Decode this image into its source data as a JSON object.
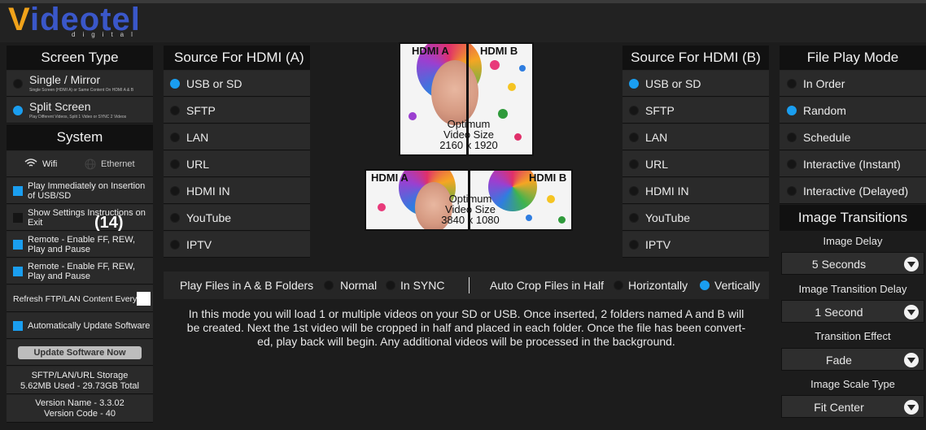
{
  "app": {
    "logo_main": "ideotel",
    "logo_v": "V",
    "logo_sub": "digital"
  },
  "screen_type": {
    "header": "Screen Type",
    "options": [
      {
        "label": "Single / Mirror",
        "desc": "Single Screen (HDMI A) or Same Content On HDMI A & B",
        "selected": false
      },
      {
        "label": "Split Screen",
        "desc": "Play Different Videos, Split 1 Video or SYNC 2 Videos",
        "selected": true
      }
    ]
  },
  "system": {
    "header": "System",
    "wifi_label": "Wifi",
    "ethernet_label": "Ethernet",
    "settings": [
      {
        "label": "Play Immediately on Insertion of USB/SD",
        "checked": true
      },
      {
        "label": "Show Settings Instructions on Exit",
        "checked": false
      },
      {
        "label": "Remote - Enable FF, REW, Play and Pause",
        "checked": true
      },
      {
        "label": "Remote - Enable FF, REW, Play and Pause",
        "checked": true
      }
    ],
    "overlay_count": "(14)",
    "refresh_label": "Refresh FTP/LAN Content Every:",
    "refresh_value": "",
    "auto_update_label": "Automatically Update Software",
    "update_button": "Update Software Now",
    "storage_title": "SFTP/LAN/URL Storage",
    "storage_value": "5.62MB Used - 29.73GB Total",
    "version_name": "Version Name - 3.3.02",
    "version_code": "Version Code - 40"
  },
  "source_a": {
    "header": "Source For HDMI (A)",
    "options": [
      "USB or SD",
      "SFTP",
      "LAN",
      "URL",
      "HDMI IN",
      "YouTube",
      "IPTV"
    ],
    "selected": 0
  },
  "source_b": {
    "header": "Source For HDMI (B)",
    "options": [
      "USB or SD",
      "SFTP",
      "LAN",
      "URL",
      "HDMI IN",
      "YouTube",
      "IPTV"
    ],
    "selected": 0
  },
  "previews": {
    "portrait": {
      "label_a": "HDMI A",
      "label_b": "HDMI B",
      "opt_1": "Optimum",
      "opt_2": "Video Size",
      "opt_3": "2160 x 1920"
    },
    "landscape": {
      "label_a": "HDMI A",
      "label_b": "HDMI B",
      "opt_1": "Optimum",
      "opt_2": "Video Size",
      "opt_3": "3840 x 1080"
    }
  },
  "play_files": {
    "label": "Play Files in A & B Folders",
    "normal": "Normal",
    "sync": "In SYNC",
    "auto_crop": "Auto Crop Files in Half",
    "horizontal": "Horizontally",
    "vertical": "Vertically"
  },
  "description": {
    "line1": "In this mode you will load 1 or multiple videos on your SD or USB. Once inserted, 2 folders named A and B will",
    "line2": "be created. Next the 1st video will be cropped in half and placed in each folder. Once the file has been convert-",
    "line3": "ed, play back will begin. Any additional videos will be processed in the background."
  },
  "file_play_mode": {
    "header": "File Play Mode",
    "options": [
      "In Order",
      "Random",
      "Schedule",
      "Interactive  (Instant)",
      "Interactive (Delayed)"
    ],
    "selected": 1
  },
  "image_transitions": {
    "header": "Image Transitions",
    "delay_label": "Image Delay",
    "delay_value": "5 Seconds",
    "transition_delay_label": "Image Transition Delay",
    "transition_delay_value": "1 Second",
    "effect_label": "Transition Effect",
    "effect_value": "Fade",
    "scale_label": "Image Scale Type",
    "scale_value": "Fit Center"
  },
  "colors": {
    "accent": "#1a9ef0",
    "logo_blue": "#3a57c9",
    "logo_orange": "#f0a21a"
  }
}
